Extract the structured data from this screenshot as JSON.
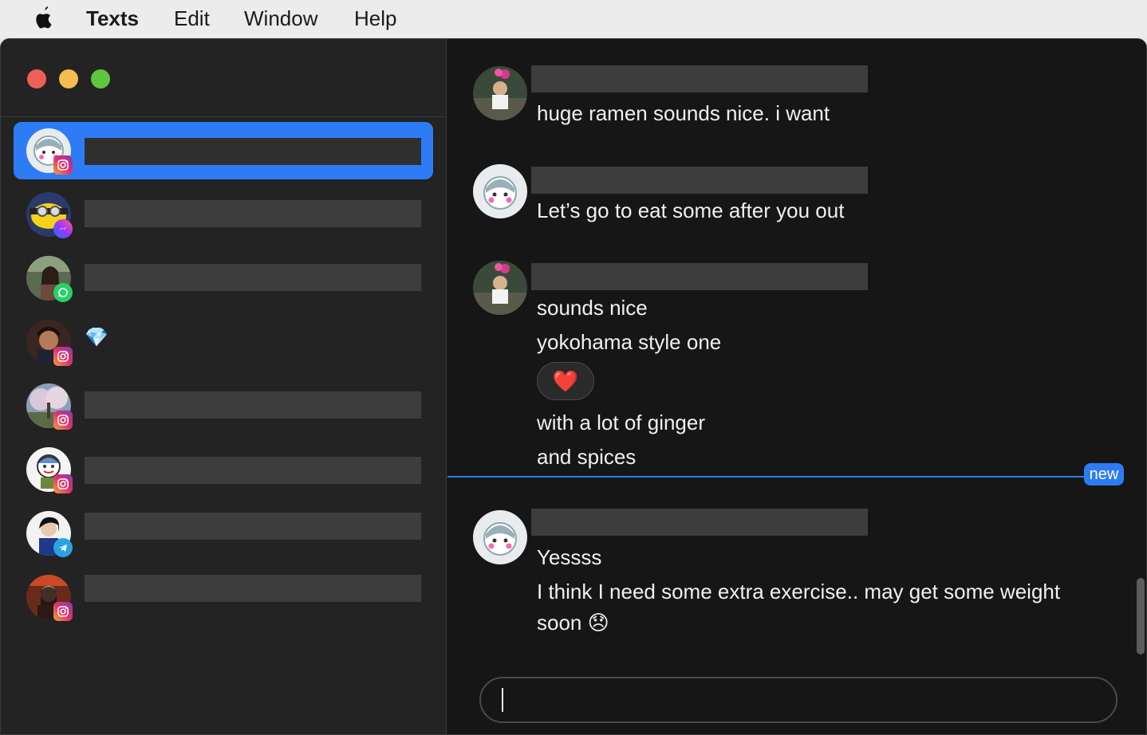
{
  "menubar": {
    "app_name": "Texts",
    "items": [
      "Edit",
      "Window",
      "Help"
    ]
  },
  "sidebar": {
    "chats": [
      {
        "name": "",
        "network": "instagram-icon",
        "selected": true
      },
      {
        "name": "",
        "network": "messenger-icon",
        "selected": false
      },
      {
        "name": "",
        "network": "whatsapp-icon",
        "selected": false
      },
      {
        "name": "💎",
        "network": "instagram-icon",
        "selected": false
      },
      {
        "name": "",
        "network": "instagram-icon",
        "selected": false
      },
      {
        "name": "",
        "network": "instagram-icon",
        "selected": false
      },
      {
        "name": "",
        "network": "telegram-icon",
        "selected": false
      },
      {
        "name": "",
        "network": "instagram-icon",
        "selected": false
      }
    ]
  },
  "thread": {
    "messages": [
      {
        "text": "huge ramen sounds nice. i want"
      },
      {
        "text": "Let’s go to eat some after you out"
      },
      {
        "text": "sounds nice"
      },
      {
        "text": "yokohama style one"
      },
      {
        "reaction": "❤️"
      },
      {
        "text": "with a lot of ginger"
      },
      {
        "text": "and spices"
      },
      {
        "text": "Yessss"
      },
      {
        "text_line1": "I think I need some extra exercise.. may get some weight",
        "text_line2": "soon 😞"
      }
    ],
    "new_label": "new"
  },
  "colors": {
    "accent": "#2d7cf6",
    "background": "#161616",
    "sidebar": "#232323"
  }
}
